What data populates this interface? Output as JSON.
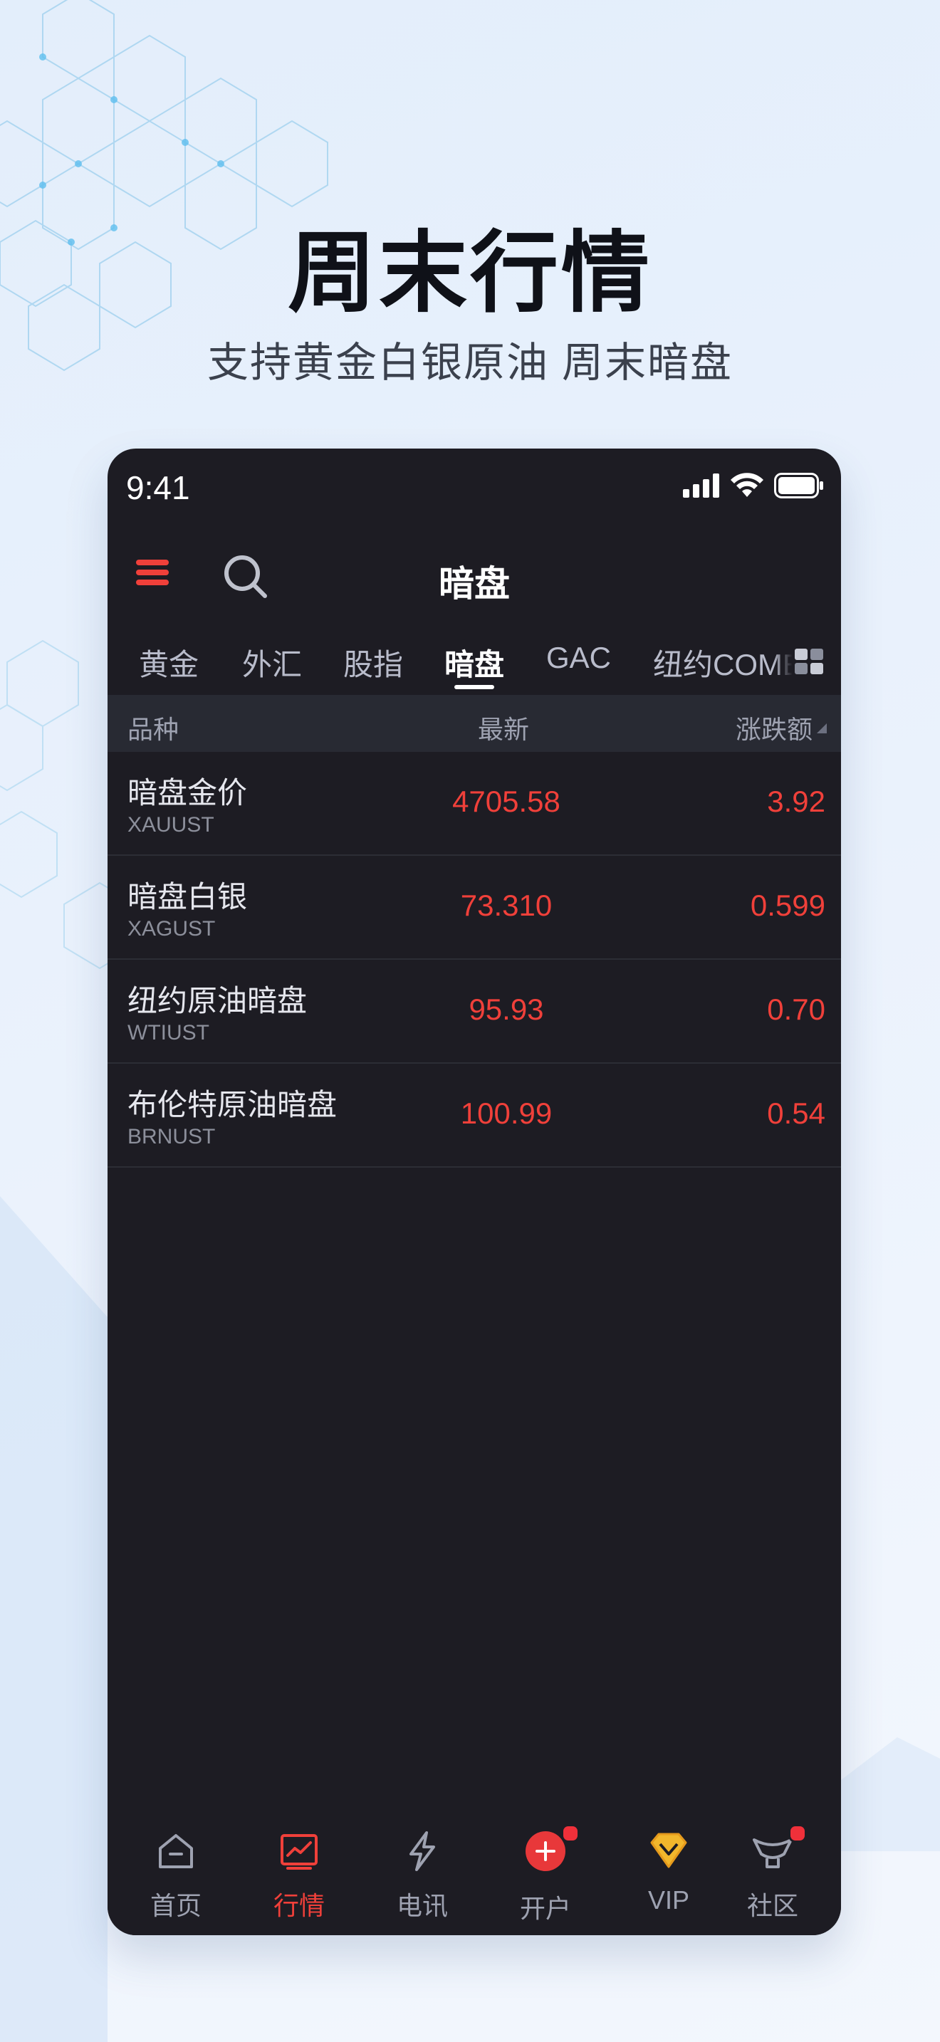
{
  "promo": {
    "title": "周末行情",
    "subtitle": "支持黄金白银原油 周末暗盘"
  },
  "status_bar": {
    "time": "9:41",
    "icons": [
      "signal-icon",
      "wifi-icon",
      "battery-icon"
    ]
  },
  "navbar": {
    "title": "暗盘",
    "menu_icon": "menu-icon",
    "search_icon": "search-icon"
  },
  "tabs": {
    "items": [
      "黄金",
      "外汇",
      "股指",
      "暗盘",
      "GAC",
      "纽约COMEX"
    ],
    "active": "暗盘",
    "more_icon": "grid-icon"
  },
  "table": {
    "headers": {
      "name": "品种",
      "latest": "最新",
      "change": "涨跌额"
    },
    "rows": [
      {
        "name": "暗盘金价",
        "code": "XAUUST",
        "latest": "4705.58",
        "change": "3.92"
      },
      {
        "name": "暗盘白银",
        "code": "XAGUST",
        "latest": "73.310",
        "change": "0.599"
      },
      {
        "name": "纽约原油暗盘",
        "code": "WTIUST",
        "latest": "95.93",
        "change": "0.70"
      },
      {
        "name": "布伦特原油暗盘",
        "code": "BRNUST",
        "latest": "100.99",
        "change": "0.54"
      }
    ]
  },
  "bottom_nav": {
    "items": [
      {
        "label": "首页",
        "icon": "home-icon"
      },
      {
        "label": "行情",
        "icon": "chart-icon"
      },
      {
        "label": "电讯",
        "icon": "lightning-icon"
      },
      {
        "label": "开户",
        "icon": "plus-circle-icon"
      },
      {
        "label": "VIP",
        "icon": "diamond-icon"
      },
      {
        "label": "社区",
        "icon": "community-icon"
      }
    ],
    "active": "行情"
  },
  "colors": {
    "accent_red": "#f0403a",
    "phone_bg": "#1d1c23",
    "header_bg": "#282a33",
    "vip_gold": "#f2b72c"
  }
}
